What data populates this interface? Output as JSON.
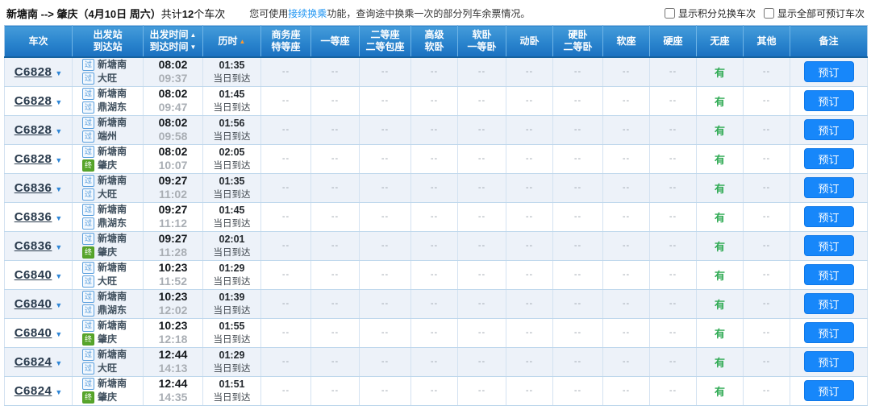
{
  "colors": {
    "header_blue_top": "#459cda",
    "header_blue_bottom": "#1a70c0",
    "booking_button_blue": "#1787fa",
    "link_blue": "#2196f3",
    "available_green": "#2faa53",
    "sort_active_orange": "#ff9a2e",
    "terminal_badge_green": "#57a52b",
    "pass_badge_blue": "#3f8fd6",
    "odd_row_background": "#edf2f9"
  },
  "topbar": {
    "route_summary": "新塘南 --> 肇庆（4月10日 周六）",
    "count_prefix": "共计",
    "count": "12",
    "count_suffix": "个车次",
    "tip_prefix": "您可使用",
    "tip_link": "接续换乘",
    "tip_suffix": "功能，查询途中换乘一次的部分列车余票情况。",
    "checkbox_points": "显示积分兑换车次",
    "checkbox_all": "显示全部可预订车次"
  },
  "table": {
    "book_label": "预订",
    "dash": "--",
    "available_label": "有",
    "columns": [
      {
        "id": "train-no",
        "lines": [
          {
            "text": "车次"
          }
        ]
      },
      {
        "id": "stations",
        "lines": [
          {
            "text": "出发站"
          },
          {
            "text": "到达站"
          }
        ]
      },
      {
        "id": "times",
        "lines": [
          {
            "text": "出发时间",
            "arrow": "up"
          },
          {
            "text": "到达时间",
            "arrow": "down"
          }
        ]
      },
      {
        "id": "duration",
        "lines": [
          {
            "text": "历时",
            "arrow": "up-active"
          }
        ]
      },
      {
        "id": "business-premier-seat",
        "lines": [
          {
            "text": "商务座"
          },
          {
            "text": "特等座"
          }
        ]
      },
      {
        "id": "first-class-seat",
        "lines": [
          {
            "text": "一等座"
          }
        ]
      },
      {
        "id": "second-class-seat",
        "lines": [
          {
            "text": "二等座"
          },
          {
            "text": "二等包座"
          }
        ]
      },
      {
        "id": "premium-soft-sleeper",
        "lines": [
          {
            "text": "高级"
          },
          {
            "text": "软卧"
          }
        ]
      },
      {
        "id": "soft-sleeper",
        "lines": [
          {
            "text": "软卧"
          },
          {
            "text": "一等卧"
          }
        ]
      },
      {
        "id": "bullet-sleeper",
        "lines": [
          {
            "text": "动卧"
          }
        ]
      },
      {
        "id": "hard-sleeper",
        "lines": [
          {
            "text": "硬卧"
          },
          {
            "text": "二等卧"
          }
        ]
      },
      {
        "id": "soft-seat",
        "lines": [
          {
            "text": "软座"
          }
        ]
      },
      {
        "id": "hard-seat",
        "lines": [
          {
            "text": "硬座"
          }
        ]
      },
      {
        "id": "no-seat",
        "lines": [
          {
            "text": "无座"
          }
        ]
      },
      {
        "id": "other",
        "lines": [
          {
            "text": "其他"
          }
        ]
      },
      {
        "id": "remarks",
        "lines": [
          {
            "text": "备注"
          }
        ]
      }
    ],
    "rows": [
      {
        "train": "C6828",
        "from_badge": "过",
        "from": "新塘南",
        "to_badge": "过",
        "to": "大旺",
        "dep": "08:02",
        "arr": "09:37",
        "dur": "01:35",
        "day": "当日到达",
        "seats": [
          "--",
          "--",
          "--",
          "--",
          "--",
          "--",
          "--",
          "--",
          "--",
          "有",
          "--"
        ]
      },
      {
        "train": "C6828",
        "from_badge": "过",
        "from": "新塘南",
        "to_badge": "过",
        "to": "鼎湖东",
        "dep": "08:02",
        "arr": "09:47",
        "dur": "01:45",
        "day": "当日到达",
        "seats": [
          "--",
          "--",
          "--",
          "--",
          "--",
          "--",
          "--",
          "--",
          "--",
          "有",
          "--"
        ]
      },
      {
        "train": "C6828",
        "from_badge": "过",
        "from": "新塘南",
        "to_badge": "过",
        "to": "端州",
        "dep": "08:02",
        "arr": "09:58",
        "dur": "01:56",
        "day": "当日到达",
        "seats": [
          "--",
          "--",
          "--",
          "--",
          "--",
          "--",
          "--",
          "--",
          "--",
          "有",
          "--"
        ]
      },
      {
        "train": "C6828",
        "from_badge": "过",
        "from": "新塘南",
        "to_badge": "终",
        "to": "肇庆",
        "dep": "08:02",
        "arr": "10:07",
        "dur": "02:05",
        "day": "当日到达",
        "seats": [
          "--",
          "--",
          "--",
          "--",
          "--",
          "--",
          "--",
          "--",
          "--",
          "有",
          "--"
        ]
      },
      {
        "train": "C6836",
        "from_badge": "过",
        "from": "新塘南",
        "to_badge": "过",
        "to": "大旺",
        "dep": "09:27",
        "arr": "11:02",
        "dur": "01:35",
        "day": "当日到达",
        "seats": [
          "--",
          "--",
          "--",
          "--",
          "--",
          "--",
          "--",
          "--",
          "--",
          "有",
          "--"
        ]
      },
      {
        "train": "C6836",
        "from_badge": "过",
        "from": "新塘南",
        "to_badge": "过",
        "to": "鼎湖东",
        "dep": "09:27",
        "arr": "11:12",
        "dur": "01:45",
        "day": "当日到达",
        "seats": [
          "--",
          "--",
          "--",
          "--",
          "--",
          "--",
          "--",
          "--",
          "--",
          "有",
          "--"
        ]
      },
      {
        "train": "C6836",
        "from_badge": "过",
        "from": "新塘南",
        "to_badge": "终",
        "to": "肇庆",
        "dep": "09:27",
        "arr": "11:28",
        "dur": "02:01",
        "day": "当日到达",
        "seats": [
          "--",
          "--",
          "--",
          "--",
          "--",
          "--",
          "--",
          "--",
          "--",
          "有",
          "--"
        ]
      },
      {
        "train": "C6840",
        "from_badge": "过",
        "from": "新塘南",
        "to_badge": "过",
        "to": "大旺",
        "dep": "10:23",
        "arr": "11:52",
        "dur": "01:29",
        "day": "当日到达",
        "seats": [
          "--",
          "--",
          "--",
          "--",
          "--",
          "--",
          "--",
          "--",
          "--",
          "有",
          "--"
        ]
      },
      {
        "train": "C6840",
        "from_badge": "过",
        "from": "新塘南",
        "to_badge": "过",
        "to": "鼎湖东",
        "dep": "10:23",
        "arr": "12:02",
        "dur": "01:39",
        "day": "当日到达",
        "seats": [
          "--",
          "--",
          "--",
          "--",
          "--",
          "--",
          "--",
          "--",
          "--",
          "有",
          "--"
        ]
      },
      {
        "train": "C6840",
        "from_badge": "过",
        "from": "新塘南",
        "to_badge": "终",
        "to": "肇庆",
        "dep": "10:23",
        "arr": "12:18",
        "dur": "01:55",
        "day": "当日到达",
        "seats": [
          "--",
          "--",
          "--",
          "--",
          "--",
          "--",
          "--",
          "--",
          "--",
          "有",
          "--"
        ]
      },
      {
        "train": "C6824",
        "from_badge": "过",
        "from": "新塘南",
        "to_badge": "过",
        "to": "大旺",
        "dep": "12:44",
        "arr": "14:13",
        "dur": "01:29",
        "day": "当日到达",
        "seats": [
          "--",
          "--",
          "--",
          "--",
          "--",
          "--",
          "--",
          "--",
          "--",
          "有",
          "--"
        ]
      },
      {
        "train": "C6824",
        "from_badge": "过",
        "from": "新塘南",
        "to_badge": "终",
        "to": "肇庆",
        "dep": "12:44",
        "arr": "14:35",
        "dur": "01:51",
        "day": "当日到达",
        "seats": [
          "--",
          "--",
          "--",
          "--",
          "--",
          "--",
          "--",
          "--",
          "--",
          "有",
          "--"
        ]
      }
    ]
  }
}
